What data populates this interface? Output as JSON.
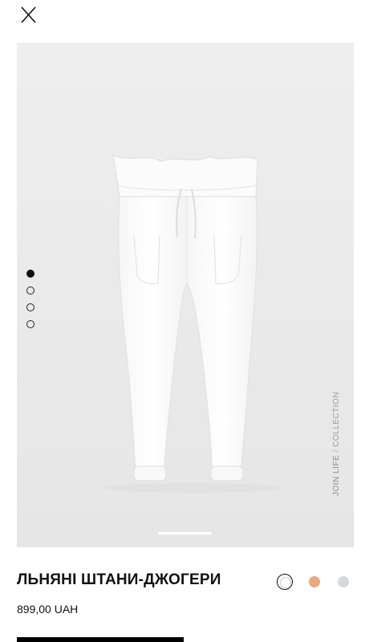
{
  "header": {
    "close_icon": "close-icon"
  },
  "gallery": {
    "image_alt": "white linen jogger trousers",
    "image_count": 4,
    "active_index": 0,
    "side_label": {
      "brand": "JOIN LIFE",
      "separator": " / ",
      "suffix": "COLLECTION"
    }
  },
  "product": {
    "title": "ЛЬНЯНІ ШТАНИ-ДЖОГЕРИ",
    "price": "899,00 UAH",
    "colors": [
      {
        "name": "white",
        "hex": "#ffffff",
        "selected": true
      },
      {
        "name": "peach",
        "hex": "#e8a97f",
        "selected": false
      },
      {
        "name": "light-grey",
        "hex": "#d2d8db",
        "selected": false
      }
    ]
  },
  "colors": {
    "background": "#ffffff",
    "gallery_bg": "#ececec",
    "text": "#111111"
  }
}
